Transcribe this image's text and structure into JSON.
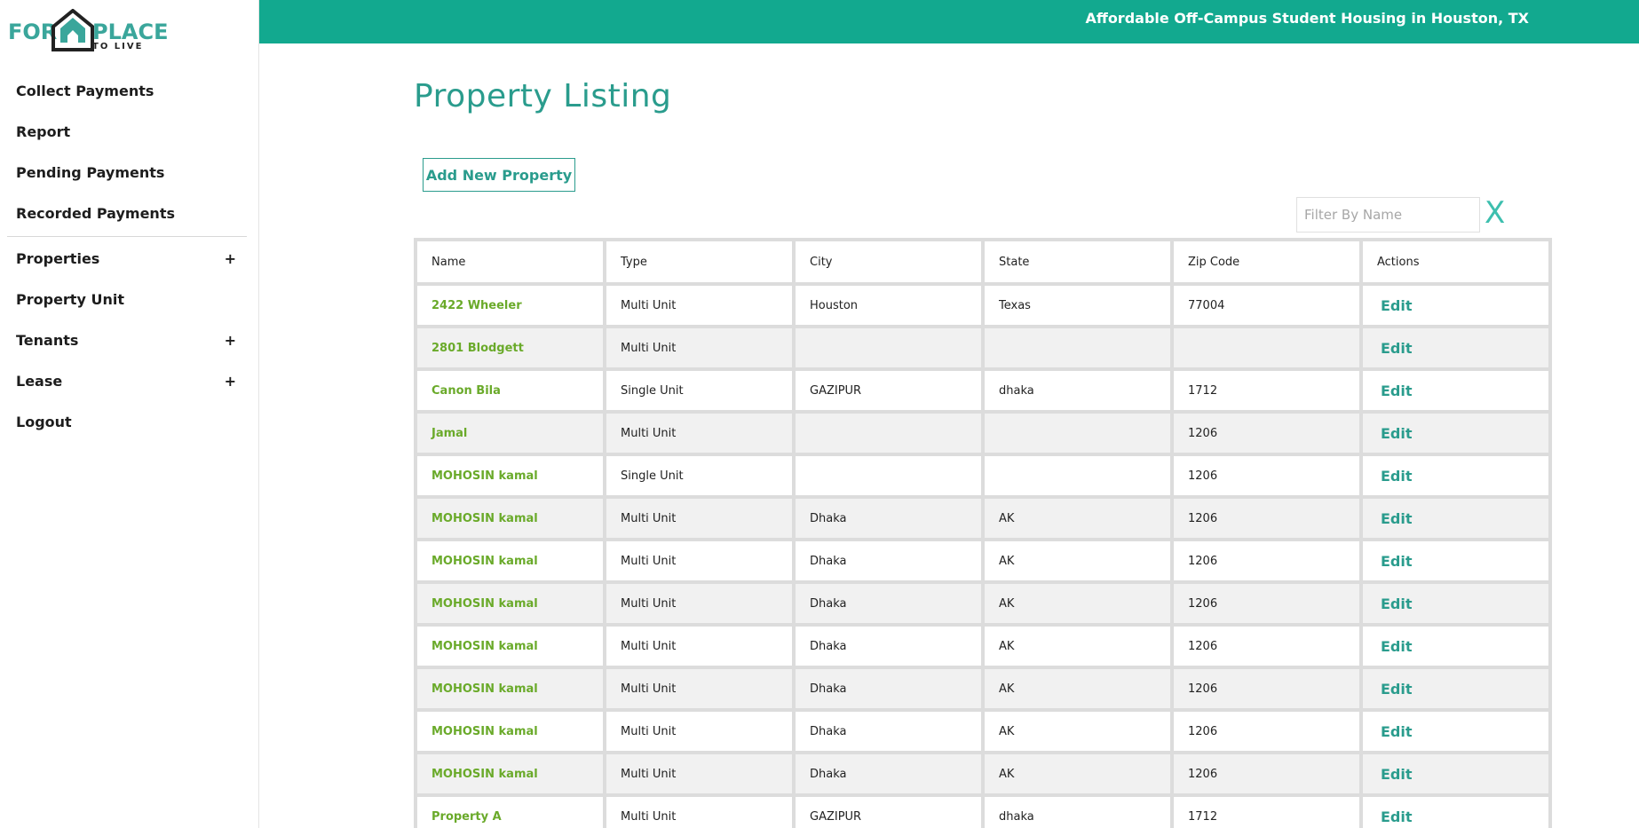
{
  "brand": {
    "logo_for": "FOR",
    "logo_place": "PLACE",
    "logo_tolive": "TO LIVE"
  },
  "header": {
    "title": "Affordable Off-Campus Student Housing in Houston, TX"
  },
  "sidebar": {
    "items": [
      {
        "label": "Collect Payments",
        "expandable": false
      },
      {
        "label": "Report",
        "expandable": false
      },
      {
        "label": "Pending Payments",
        "expandable": false
      },
      {
        "label": "Recorded Payments",
        "expandable": false
      },
      {
        "label": "Properties",
        "expandable": true
      },
      {
        "label": "Property Unit",
        "expandable": false
      },
      {
        "label": "Tenants",
        "expandable": true
      },
      {
        "label": "Lease",
        "expandable": true
      },
      {
        "label": "Logout",
        "expandable": false
      }
    ],
    "plus_symbol": "+"
  },
  "main": {
    "page_title": "Property Listing",
    "add_button_label": "Add New Property",
    "filter_placeholder": "Filter By Name",
    "clear_label": "X"
  },
  "table": {
    "columns": [
      "Name",
      "Type",
      "City",
      "State",
      "Zip Code",
      "Actions"
    ],
    "action_label": "Edit",
    "rows": [
      {
        "name": "2422 Wheeler",
        "type": "Multi Unit",
        "city": "Houston",
        "state": "Texas",
        "zip": "77004"
      },
      {
        "name": "2801 Blodgett",
        "type": "Multi Unit",
        "city": "",
        "state": "",
        "zip": ""
      },
      {
        "name": "Canon Bila",
        "type": "Single Unit",
        "city": "GAZIPUR",
        "state": "dhaka",
        "zip": "1712"
      },
      {
        "name": "Jamal",
        "type": "Multi Unit",
        "city": "",
        "state": "",
        "zip": "1206"
      },
      {
        "name": "MOHOSIN kamal",
        "type": "Single Unit",
        "city": "",
        "state": "",
        "zip": "1206"
      },
      {
        "name": "MOHOSIN kamal",
        "type": "Multi Unit",
        "city": "Dhaka",
        "state": "AK",
        "zip": "1206"
      },
      {
        "name": "MOHOSIN kamal",
        "type": "Multi Unit",
        "city": "Dhaka",
        "state": "AK",
        "zip": "1206"
      },
      {
        "name": "MOHOSIN kamal",
        "type": "Multi Unit",
        "city": "Dhaka",
        "state": "AK",
        "zip": "1206"
      },
      {
        "name": "MOHOSIN kamal",
        "type": "Multi Unit",
        "city": "Dhaka",
        "state": "AK",
        "zip": "1206"
      },
      {
        "name": "MOHOSIN kamal",
        "type": "Multi Unit",
        "city": "Dhaka",
        "state": "AK",
        "zip": "1206"
      },
      {
        "name": "MOHOSIN kamal",
        "type": "Multi Unit",
        "city": "Dhaka",
        "state": "AK",
        "zip": "1206"
      },
      {
        "name": "MOHOSIN kamal",
        "type": "Multi Unit",
        "city": "Dhaka",
        "state": "AK",
        "zip": "1206"
      },
      {
        "name": "Property A",
        "type": "Multi Unit",
        "city": "GAZIPUR",
        "state": "dhaka",
        "zip": "1712"
      }
    ]
  },
  "colors": {
    "brand_teal": "#12a98f",
    "title_teal": "#2a9c8d",
    "name_green": "#6aaa2a"
  }
}
